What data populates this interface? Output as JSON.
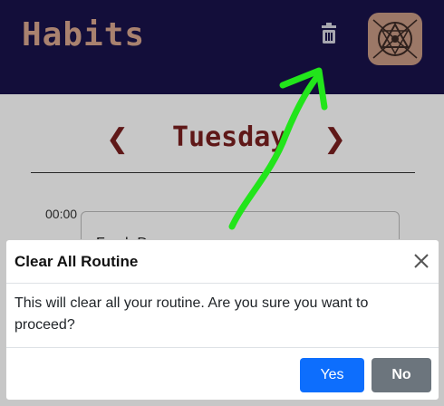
{
  "header": {
    "app_title": "Habits",
    "trash_icon": "trash-icon",
    "avatar_icon": "avatar-emblem"
  },
  "day_navigation": {
    "prev_symbol": "❮",
    "next_symbol": "❯",
    "day": "Tuesday"
  },
  "schedule": {
    "time": "00:00",
    "routine_partial": "Fresh Dr..."
  },
  "modal": {
    "title": "Clear All Routine",
    "body": "This will clear all your routine. Are you sure you want to proceed?",
    "yes_label": "Yes",
    "no_label": "No",
    "close_icon": "close-icon"
  },
  "colors": {
    "header_bg": "#19124b",
    "title": "#d9a78f",
    "day_text": "#7a1f1f",
    "yes_button": "#0d6efd",
    "no_button": "#6c757d",
    "annotation_arrow": "#22e51b"
  }
}
